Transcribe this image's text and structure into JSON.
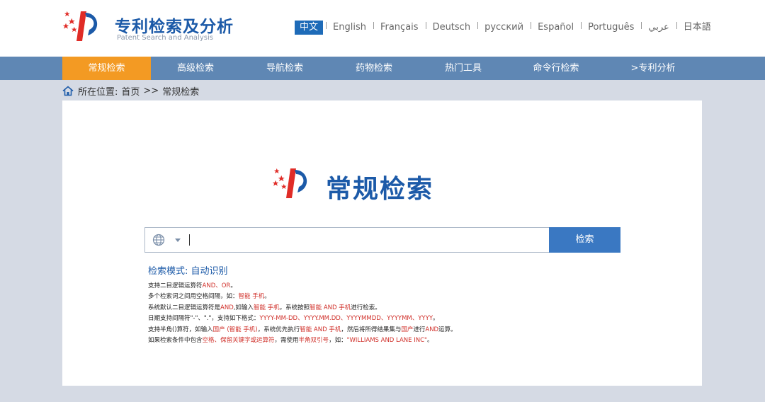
{
  "brand": {
    "title": "专利检索及分析",
    "subtitle": "Patent Search and Analysis"
  },
  "languages": [
    "中文",
    "English",
    "Français",
    "Deutsch",
    "русский",
    "Español",
    "Português",
    "عربي",
    "日本語"
  ],
  "active_language": "中文",
  "nav": {
    "items": [
      "常规检索",
      "高级检索",
      "导航检索",
      "药物检索",
      "热门工具",
      "命令行检索",
      ">专利分析"
    ],
    "active": "常规检索"
  },
  "breadcrumb": {
    "label": "所在位置:",
    "home": "首页",
    "sep": ">>",
    "current": "常规检索"
  },
  "main": {
    "title": "常规检索",
    "search": {
      "value": "",
      "button": "检索"
    },
    "mode_label": "检索模式: 自动识别"
  },
  "help": {
    "lines": [
      {
        "parts": [
          [
            "支持二目逻辑运算符",
            false
          ],
          [
            "AND、OR",
            true
          ],
          [
            "。",
            false
          ]
        ]
      },
      {
        "parts": [
          [
            "多个检索词之间用空格间隔，如：",
            false
          ],
          [
            "智能 手机",
            true
          ],
          [
            "。",
            false
          ]
        ]
      },
      {
        "parts": [
          [
            "系统默认二目逻辑运算符是",
            false
          ],
          [
            "AND",
            true
          ],
          [
            ",如输入",
            false
          ],
          [
            "智能 手机",
            true
          ],
          [
            "，系统按照",
            false
          ],
          [
            "智能 AND 手机",
            true
          ],
          [
            "进行检索。",
            false
          ]
        ]
      },
      {
        "parts": [
          [
            "日期支持间隔符\"-\"、\".\"，支持如下格式：",
            false
          ],
          [
            "YYYY-MM-DD、YYYY.MM.DD、YYYYMMDD、YYYYMM、YYYY",
            true
          ],
          [
            "。",
            false
          ]
        ]
      },
      {
        "parts": [
          [
            "支持半角()算符，如输入",
            false
          ],
          [
            "国产 (智能 手机)",
            true
          ],
          [
            "，系统优先执行",
            false
          ],
          [
            "智能 AND 手机",
            true
          ],
          [
            "，然后将所得结果集与",
            false
          ],
          [
            "国产",
            true
          ],
          [
            "进行",
            false
          ],
          [
            "AND",
            true
          ],
          [
            "运算。",
            false
          ]
        ]
      },
      {
        "parts": [
          [
            "如果检索条件中包含",
            false
          ],
          [
            "空格、保留关键字或运算符",
            true
          ],
          [
            "，需使用",
            false
          ],
          [
            "半角双引号",
            true
          ],
          [
            "，如：",
            false
          ],
          [
            "\"WILLIAMS AND LANE INC\"",
            true
          ],
          [
            "。",
            false
          ]
        ]
      }
    ]
  },
  "icons": {
    "logo": "patent-logo-icon",
    "home": "home-icon",
    "globe": "globe-icon",
    "dropdown": "chevron-down-icon"
  },
  "colors": {
    "brand_blue": "#1c5aa8",
    "nav_bg": "#5f87b4",
    "nav_active": "#f39a23",
    "highlight_red": "#d0302a",
    "button_blue": "#3a78c2"
  }
}
